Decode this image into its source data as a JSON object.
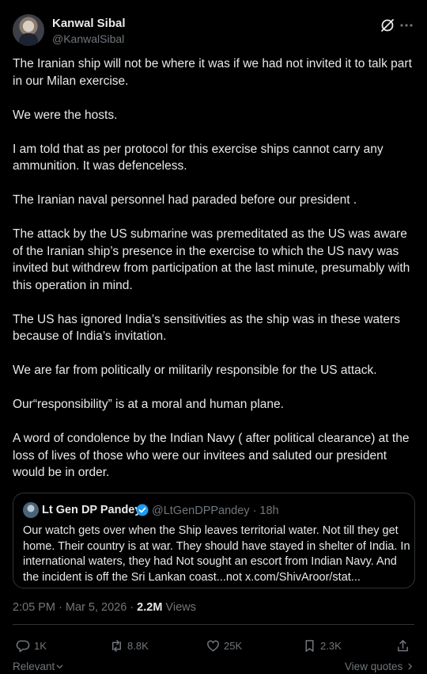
{
  "author": {
    "name": "Kanwal Sibal",
    "handle": "@KanwalSibal"
  },
  "tweet": {
    "paragraphs": [
      "The Iranian ship will not be where it was if we had not invited it to talk part in our Milan exercise.",
      "We were the hosts.",
      "I am told that as per protocol for this exercise  ships cannot carry any ammunition. It was defenceless.",
      "The Iranian naval personnel had paraded before our president .",
      "The attack by the US submarine was premeditated as the US was aware of the Iranian ship’s presence in the exercise to which the US navy was invited but withdrew from participation at the last minute, presumably with this operation in mind.",
      "The US has ignored India’s sensitivities as the ship was in these waters because of India’s invitation.",
      "We are far from politically or militarily responsible for the US attack.",
      "Our“responsibility” is at a moral and human plane.",
      "A word of condolence by the Indian Navy ( after political clearance) at the loss of lives of those who were our invitees and saluted our president would be in order."
    ]
  },
  "quoted": {
    "name": "Lt Gen DP Pandey",
    "handle_time": "@LtGenDPPandey · 18h",
    "text": "Our watch gets over when the Ship leaves territorial water. Not till they get home. Their country is at war. They should have stayed in shelter of India. In international waters, they had Not sought an escort from Indian Navy. And the incident is off the Sri Lankan coast...not x.com/ShivAroor/stat..."
  },
  "meta": {
    "time_date": "2:05 PM · Mar 5, 2026 · ",
    "views_count": "2.2M",
    "views_label": " Views"
  },
  "actions": {
    "replies": "1K",
    "reposts": "8.8K",
    "likes": "25K",
    "bookmarks": "2.3K"
  },
  "footer": {
    "sort_label": "Relevant",
    "view_quotes_label": "View quotes"
  },
  "colors": {
    "background": "#000000",
    "text": "#e7e9ea",
    "secondary": "#71767b",
    "verified": "#1d9bf0",
    "border": "#2f3336"
  }
}
